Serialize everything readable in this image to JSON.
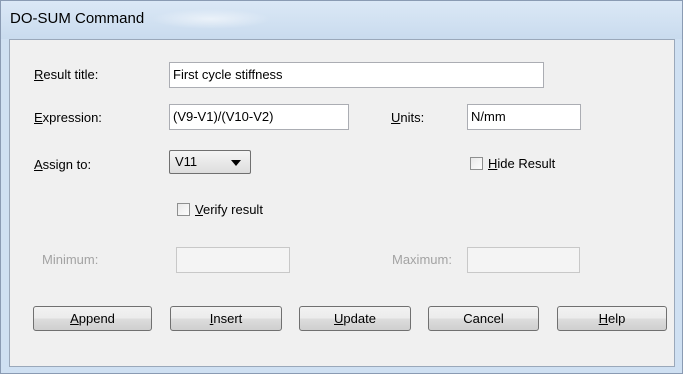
{
  "window": {
    "title": "DO-SUM Command"
  },
  "form": {
    "result_title": {
      "label_accel": "R",
      "label_rest": "esult title:",
      "value": "First cycle stiffness"
    },
    "expression": {
      "label_accel": "E",
      "label_rest": "xpression:",
      "value": "(V9-V1)/(V10-V2)"
    },
    "units": {
      "label_accel": "U",
      "label_rest": "nits:",
      "value": "N/mm"
    },
    "assign_to": {
      "label_accel": "A",
      "label_rest": "ssign to:",
      "selected": "V11"
    },
    "hide_result": {
      "label_accel": "H",
      "label_rest": "ide Result",
      "checked": false
    },
    "verify_result": {
      "label_accel": "V",
      "label_rest": "erify result",
      "checked": false
    },
    "minimum": {
      "label": "Minimum:",
      "value": ""
    },
    "maximum": {
      "label": "Maximum:",
      "value": ""
    }
  },
  "buttons": {
    "append": {
      "accel": "A",
      "rest": "ppend"
    },
    "insert": {
      "accel": "I",
      "rest": "nsert"
    },
    "update": {
      "accel": "U",
      "rest": "pdate"
    },
    "cancel": {
      "label": "Cancel"
    },
    "help": {
      "accel": "H",
      "rest": "elp"
    }
  }
}
